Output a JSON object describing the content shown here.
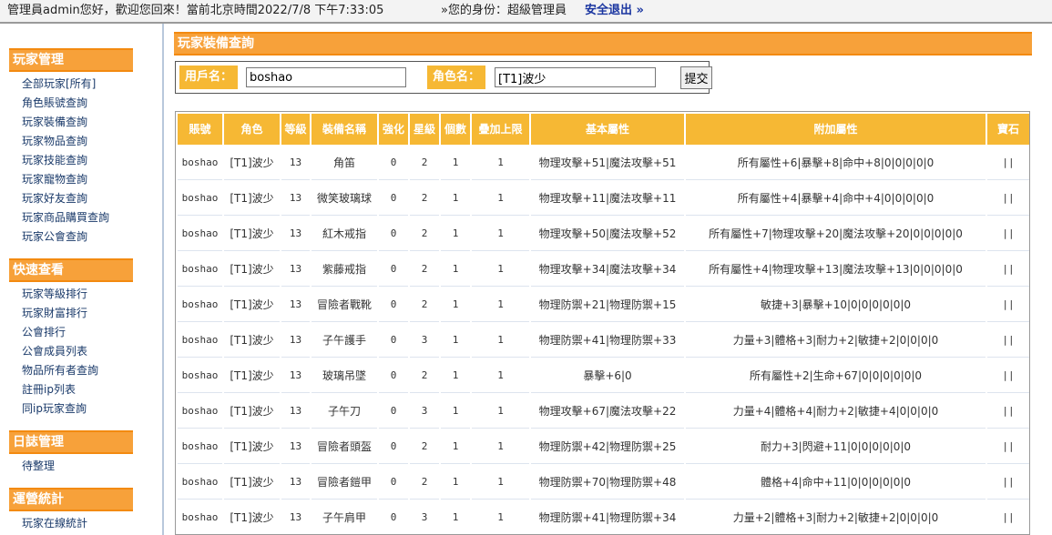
{
  "topbar": {
    "greeting": "管理員admin您好，歡迎您回來！當前北京時間2022/7/8 下午7:33:05",
    "role": "»您的身份：超級管理員",
    "logout": "安全退出 »"
  },
  "sidebar": {
    "sections": [
      {
        "title": "玩家管理",
        "items": [
          "全部玩家[所有]",
          "角色賬號查詢",
          "玩家裝備查詢",
          "玩家物品查詢",
          "玩家技能查詢",
          "玩家寵物查詢",
          "玩家好友查詢",
          "玩家商品購買查詢",
          "玩家公會查詢"
        ]
      },
      {
        "title": "快速查看",
        "items": [
          "玩家等級排行",
          "玩家財富排行",
          "公會排行",
          "公會成員列表",
          "物品所有者查詢",
          "註冊ip列表",
          "同ip玩家查詢"
        ]
      },
      {
        "title": "日誌管理",
        "items": [
          "待整理"
        ]
      },
      {
        "title": "運營統計",
        "items": [
          "玩家在線統計"
        ]
      }
    ]
  },
  "main": {
    "title": "玩家裝備查詢",
    "search": {
      "username_label": "用戶名：",
      "username_value": "boshao",
      "rolename_label": "角色名：",
      "rolename_value": "[T1]波少",
      "submit_label": "提交"
    },
    "table": {
      "headers": [
        "賬號",
        "角色",
        "等級",
        "裝備名稱",
        "強化",
        "星級",
        "個數",
        "疊加上限",
        "基本屬性",
        "附加屬性",
        "寶石"
      ],
      "rows": [
        [
          "boshao",
          "[T1]波少",
          "13",
          "角笛",
          "0",
          "2",
          "1",
          "1",
          "物理攻擊+51|魔法攻擊+51",
          "所有屬性+6|暴擊+8|命中+8|0|0|0|0|0",
          "||"
        ],
        [
          "boshao",
          "[T1]波少",
          "13",
          "微笑玻璃球",
          "0",
          "2",
          "1",
          "1",
          "物理攻擊+11|魔法攻擊+11",
          "所有屬性+4|暴擊+4|命中+4|0|0|0|0|0",
          "||"
        ],
        [
          "boshao",
          "[T1]波少",
          "13",
          "紅木戒指",
          "0",
          "2",
          "1",
          "1",
          "物理攻擊+50|魔法攻擊+52",
          "所有屬性+7|物理攻擊+20|魔法攻擊+20|0|0|0|0|0",
          "||"
        ],
        [
          "boshao",
          "[T1]波少",
          "13",
          "紫藤戒指",
          "0",
          "2",
          "1",
          "1",
          "物理攻擊+34|魔法攻擊+34",
          "所有屬性+4|物理攻擊+13|魔法攻擊+13|0|0|0|0|0",
          "||"
        ],
        [
          "boshao",
          "[T1]波少",
          "13",
          "冒險者戰靴",
          "0",
          "2",
          "1",
          "1",
          "物理防禦+21|物理防禦+15",
          "敏捷+3|暴擊+10|0|0|0|0|0|0",
          "||"
        ],
        [
          "boshao",
          "[T1]波少",
          "13",
          "子午護手",
          "0",
          "3",
          "1",
          "1",
          "物理防禦+41|物理防禦+33",
          "力量+3|體格+3|耐力+2|敏捷+2|0|0|0|0",
          "||"
        ],
        [
          "boshao",
          "[T1]波少",
          "13",
          "玻璃吊墜",
          "0",
          "2",
          "1",
          "1",
          "暴擊+6|0",
          "所有屬性+2|生命+67|0|0|0|0|0|0",
          "||"
        ],
        [
          "boshao",
          "[T1]波少",
          "13",
          "子午刀",
          "0",
          "3",
          "1",
          "1",
          "物理攻擊+67|魔法攻擊+22",
          "力量+4|體格+4|耐力+2|敏捷+4|0|0|0|0",
          "||"
        ],
        [
          "boshao",
          "[T1]波少",
          "13",
          "冒險者頭盔",
          "0",
          "2",
          "1",
          "1",
          "物理防禦+42|物理防禦+25",
          "耐力+3|閃避+11|0|0|0|0|0|0",
          "||"
        ],
        [
          "boshao",
          "[T1]波少",
          "13",
          "冒險者鎧甲",
          "0",
          "2",
          "1",
          "1",
          "物理防禦+70|物理防禦+48",
          "體格+4|命中+11|0|0|0|0|0|0",
          "||"
        ],
        [
          "boshao",
          "[T1]波少",
          "13",
          "子午肩甲",
          "0",
          "3",
          "1",
          "1",
          "物理防禦+41|物理防禦+34",
          "力量+2|體格+3|耐力+2|敏捷+2|0|0|0|0",
          "||"
        ]
      ]
    }
  }
}
